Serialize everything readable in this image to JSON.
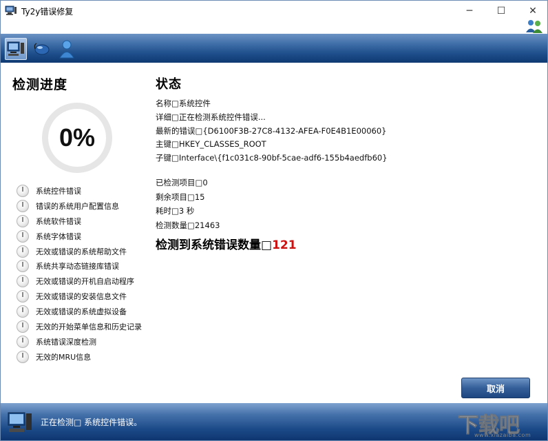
{
  "window": {
    "title": "Ty2y错误修复"
  },
  "titlebar": {
    "minimize": "─",
    "maximize": "☐",
    "close": "✕"
  },
  "icons": {
    "app": "computer-icon",
    "users": "users-icon",
    "toolbar": [
      "computer-scan-icon",
      "mouse-icon",
      "user-icon"
    ],
    "status": "computer-icon"
  },
  "left": {
    "heading": "检测进度",
    "progress": "0%",
    "items": [
      "系统控件错误",
      "错误的系统用户配置信息",
      "系统软件错误",
      "系统字体错误",
      "无效或错误的系统帮助文件",
      "系统共享动态链接库错误",
      "无效或错误的开机自启动程序",
      "无效或错误的安装信息文件",
      "无效或错误的系统虚拟设备",
      "无效的开始菜单信息和历史记录",
      "系统错误深度检测",
      "无效的MRU信息"
    ]
  },
  "right": {
    "heading": "状态",
    "name_line": "名称□系统控件",
    "detail_line": "详细□正在检测系统控件错误...",
    "latest_error_line": "最新的错误□{D6100F3B-27C8-4132-AFEA-F0E4B1E00060}",
    "main_key_line": "主键□HKEY_CLASSES_ROOT",
    "sub_key_line": "子键□Interface\\{f1c031c8-90bf-5cae-adf6-155b4aedfb60}",
    "checked_line": "已检测项目□0",
    "remaining_line": "剩余项目□15",
    "elapsed_line": "耗时□3 秒",
    "scan_count_line": "检测数量□21463",
    "detected_label": "检测到系统错误数量□",
    "detected_count": "121"
  },
  "buttons": {
    "cancel": "取消"
  },
  "status": {
    "text": "正在检测□ 系统控件错误。"
  },
  "watermark": {
    "text": "下载吧",
    "url": "www.xiazaiba.com"
  },
  "colors": {
    "accent_blue": "#1d4d8a",
    "error_red": "#cc1111"
  }
}
